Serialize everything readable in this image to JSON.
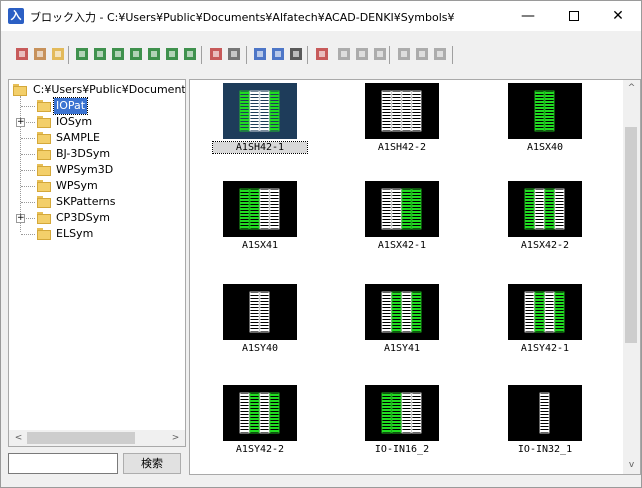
{
  "window": {
    "title": "ブロック入力 - C:¥Users¥Public¥Documents¥Alfatech¥ACAD-DENKI¥Symbols¥",
    "app_icon_glyph": "入",
    "minimize_glyph": "—",
    "close_glyph": "✕"
  },
  "toolbar": {
    "buttons": [
      {
        "name": "tree-view-icon",
        "color": "#c04040"
      },
      {
        "name": "parent-folder-icon",
        "color": "#c08040"
      },
      {
        "name": "open-folder-icon",
        "color": "#e0b040"
      },
      {
        "name": "symbol-view-1-icon",
        "color": "#208030"
      },
      {
        "name": "symbol-view-2-icon",
        "color": "#208030"
      },
      {
        "name": "symbol-view-3-icon",
        "color": "#208030"
      },
      {
        "name": "symbol-view-4-icon",
        "color": "#208030"
      },
      {
        "name": "symbol-view-5-icon",
        "color": "#208030"
      },
      {
        "name": "symbol-view-6-icon",
        "color": "#208030"
      },
      {
        "name": "symbol-view-7-icon",
        "color": "#208030"
      },
      {
        "name": "insert-block-icon",
        "color": "#c04040"
      },
      {
        "name": "properties-icon",
        "color": "#606060"
      },
      {
        "name": "large-icons-icon",
        "color": "#3060c0"
      },
      {
        "name": "small-icons-icon",
        "color": "#3060c0"
      },
      {
        "name": "list-view-icon",
        "color": "#404040"
      },
      {
        "name": "magic-wand-icon",
        "color": "#c04040"
      },
      {
        "name": "new-icon",
        "color": "#a0a0a0"
      },
      {
        "name": "copy-icon",
        "color": "#a0a0a0"
      },
      {
        "name": "save-icon",
        "color": "#a0a0a0"
      },
      {
        "name": "delete-icon",
        "color": "#a0a0a0"
      },
      {
        "name": "move-up-icon",
        "color": "#a0a0a0"
      },
      {
        "name": "move-down-icon",
        "color": "#a0a0a0"
      }
    ]
  },
  "tree": {
    "root": "C:¥Users¥Public¥Document",
    "items": [
      {
        "label": "IOPat",
        "selected": true,
        "expandable": false
      },
      {
        "label": "IOSym",
        "selected": false,
        "expandable": true
      },
      {
        "label": "SAMPLE",
        "selected": false,
        "expandable": false
      },
      {
        "label": "BJ-3DSym",
        "selected": false,
        "expandable": false
      },
      {
        "label": "WPSym3D",
        "selected": false,
        "expandable": false
      },
      {
        "label": "WPSym",
        "selected": false,
        "expandable": false
      },
      {
        "label": "SKPatterns",
        "selected": false,
        "expandable": false
      },
      {
        "label": "CP3DSym",
        "selected": false,
        "expandable": true
      },
      {
        "label": "ELSym",
        "selected": false,
        "expandable": false
      }
    ]
  },
  "search": {
    "input_value": "",
    "button_label": "検索"
  },
  "scroll": {
    "left_arrow": "<",
    "right_arrow": ">",
    "up_arrow": "^",
    "down_arrow": "v"
  },
  "symbols": [
    {
      "label": "A1SH42-1",
      "selected": true
    },
    {
      "label": "A1SH42-2",
      "selected": false
    },
    {
      "label": "A1SX40",
      "selected": false
    },
    {
      "label": "A1SX41",
      "selected": false
    },
    {
      "label": "A1SX42-1",
      "selected": false
    },
    {
      "label": "A1SX42-2",
      "selected": false
    },
    {
      "label": "A1SY40",
      "selected": false
    },
    {
      "label": "A1SY41",
      "selected": false
    },
    {
      "label": "A1SY42-1",
      "selected": false
    },
    {
      "label": "A1SY42-2",
      "selected": false
    },
    {
      "label": "IO-IN16_2",
      "selected": false
    },
    {
      "label": "IO-IN32_1",
      "selected": false
    }
  ],
  "colors": {
    "selection": "#3b73d1",
    "thumb_green": "#22dd22",
    "thumb_white": "#ffffff",
    "thumb_bg": "#000000"
  }
}
